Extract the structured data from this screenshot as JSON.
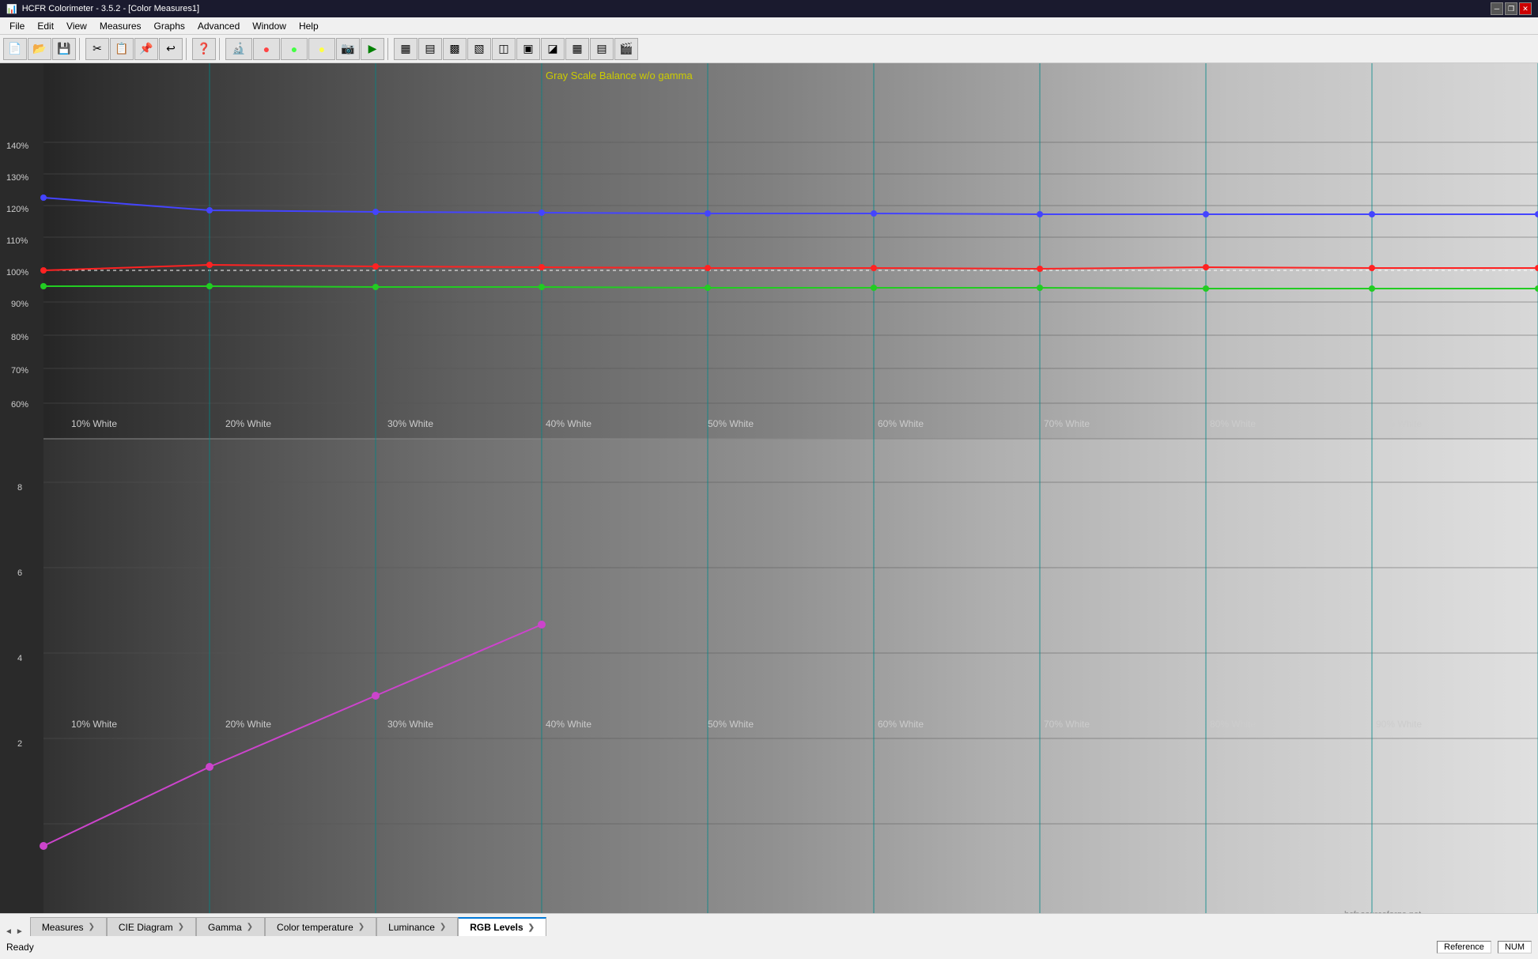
{
  "titleBar": {
    "title": "HCFR Colorimeter - 3.5.2 - [Color Measures1]",
    "icon": "📊",
    "controls": [
      "minimize",
      "maximize",
      "restore-down",
      "close"
    ]
  },
  "menuBar": {
    "items": [
      "File",
      "Edit",
      "View",
      "Measures",
      "Graphs",
      "Advanced",
      "Window",
      "Help"
    ]
  },
  "toolbar": {
    "groups": [
      [
        "new",
        "open",
        "save",
        "cut",
        "copy",
        "paste",
        "undo",
        "help"
      ],
      [
        "colorimeter",
        "rgb",
        "cyan-magenta",
        "yellow-white",
        "camera",
        "play"
      ],
      [
        "icon1",
        "icon2",
        "icon3",
        "icon4",
        "icon5",
        "icon6",
        "icon7",
        "icon8",
        "icon9",
        "icon10"
      ]
    ]
  },
  "chart": {
    "title": "Gray Scale Balance w/o gamma",
    "titleColor": "#cccc00",
    "xLabels": [
      "10% White",
      "20% White",
      "30% White",
      "40% White",
      "50% White",
      "60% White",
      "70% White",
      "80% White",
      "90% White"
    ],
    "yLabelsTop": [
      "140%",
      "130%",
      "120%",
      "110%",
      "100%",
      "90%",
      "80%",
      "70%",
      "60%"
    ],
    "yLabelsBottom": [
      "8",
      "6",
      "4",
      "2"
    ],
    "watermark": "hcfr.sourceforge.net",
    "colors": {
      "blue": "#4444ff",
      "red": "#ff2222",
      "green": "#22cc22",
      "magenta": "#cc44cc",
      "dottedLine": "#ffffff"
    }
  },
  "tabs": {
    "items": [
      "Measures",
      "CIE Diagram",
      "Gamma",
      "Color temperature",
      "Luminance",
      "RGB Levels"
    ],
    "active": "RGB Levels"
  },
  "statusBar": {
    "ready": "Ready",
    "reference": "Reference",
    "num": "NUM"
  }
}
